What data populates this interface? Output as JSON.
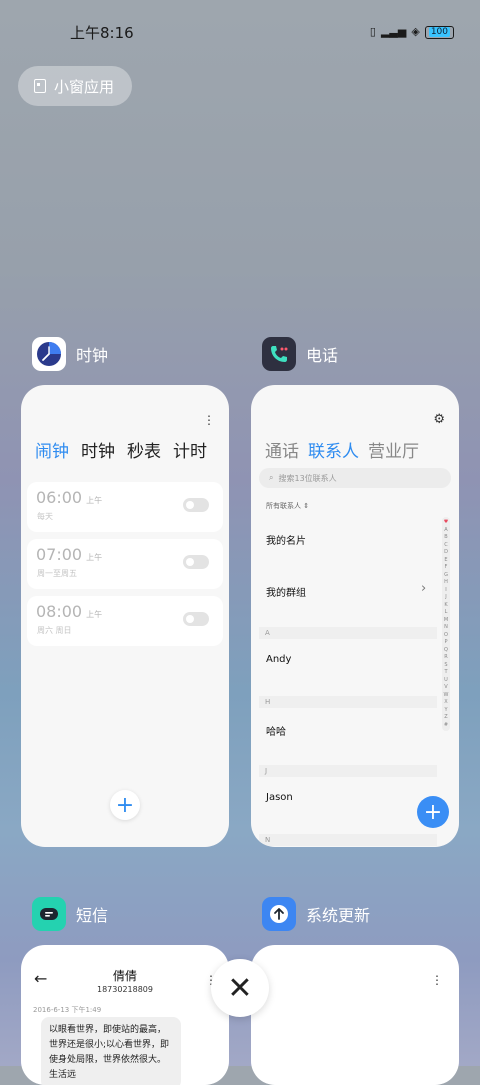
{
  "status_bar": {
    "time": "上午8:16",
    "battery": "100"
  },
  "small_window": {
    "label": "小窗应用"
  },
  "apps": {
    "clock": {
      "name": "时钟",
      "tabs": [
        "闹钟",
        "时钟",
        "秒表",
        "计时"
      ],
      "active_tab": "闹钟",
      "alarms": [
        {
          "time": "06:00",
          "ampm": "上午",
          "repeat": "每天"
        },
        {
          "time": "07:00",
          "ampm": "上午",
          "repeat": "周一至周五"
        },
        {
          "time": "08:00",
          "ampm": "上午",
          "repeat": "周六 周日"
        }
      ],
      "add_label": "+"
    },
    "phone": {
      "name": "电话",
      "tabs": [
        "通话",
        "联系人",
        "营业厅"
      ],
      "active_tab": "联系人",
      "search_placeholder": "搜索13位联系人",
      "filter_label": "所有联系人",
      "my_card": "我的名片",
      "my_groups": "我的群组",
      "sections": [
        {
          "letter": "A",
          "name": "Andy"
        },
        {
          "letter": "H",
          "name": "哈哈"
        },
        {
          "letter": "J",
          "name": "Jason"
        },
        {
          "letter": "N",
          "name": ""
        }
      ],
      "alphabet": [
        "♥",
        "A",
        "B",
        "C",
        "D",
        "E",
        "F",
        "G",
        "H",
        "I",
        "J",
        "K",
        "L",
        "M",
        "N",
        "O",
        "P",
        "Q",
        "R",
        "S",
        "T",
        "U",
        "V",
        "W",
        "X",
        "Y",
        "Z",
        "#"
      ],
      "add_label": "+"
    },
    "sms": {
      "name": "短信",
      "contact": "倩倩",
      "number": "18730218809",
      "timestamp": "2016-6-13 下午1:49",
      "message": "以眼看世界，即使站的最高，世界还是很小;以心看世界，即使身处局限，世界依然很大。生活远"
    },
    "update": {
      "name": "系统更新"
    }
  },
  "close_label": "✕",
  "colors": {
    "accent": "#2f8cf0",
    "fab_blue": "#3a8ef5"
  }
}
